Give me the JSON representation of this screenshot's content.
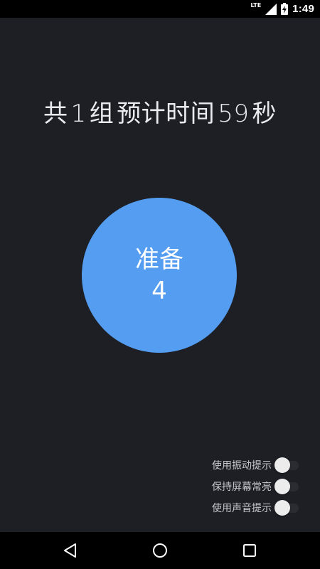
{
  "status_bar": {
    "network": "LTE",
    "time": "1:49",
    "icons": [
      "lte-icon",
      "signal-icon",
      "battery-charging-icon"
    ]
  },
  "summary": {
    "prefix": "共",
    "group_count": "1",
    "group_unit": "组",
    "time_label": "预计时间",
    "seconds": "59",
    "seconds_unit": "秒"
  },
  "timer": {
    "phase": "准备",
    "countdown": "4",
    "color": "#549df0"
  },
  "settings": [
    {
      "label": "使用振动提示",
      "on": false
    },
    {
      "label": "保持屏幕常亮",
      "on": false
    },
    {
      "label": "使用声音提示",
      "on": false
    }
  ],
  "nav": {
    "icons": [
      "back-icon",
      "home-icon",
      "recent-apps-icon"
    ]
  },
  "colors": {
    "background": "#1d1f25",
    "accent": "#549df0",
    "bars": "#000000"
  }
}
